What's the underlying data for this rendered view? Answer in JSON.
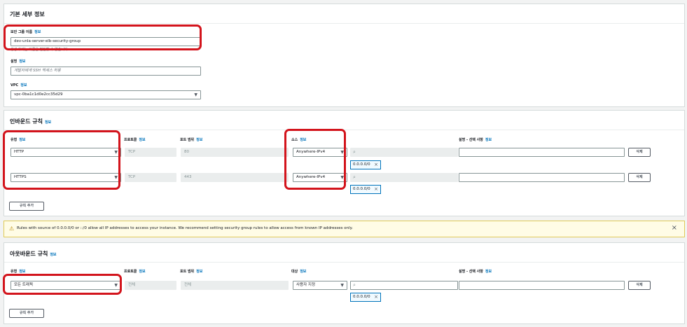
{
  "basic": {
    "title": "기본 세부 정보",
    "info": "정보",
    "sg_name_label": "보안 그룹 이름",
    "sg_name_value": "dev-unla-server-elb-security-group",
    "sg_name_hint": "생성 후에는 이름을 편집할 수 없습니다.",
    "desc_label": "설명",
    "desc_placeholder": "개발자에게 SSH 액세스 허용",
    "vpc_label": "VPC",
    "vpc_value": "vpc-0ba1c1d0e2cc35d29"
  },
  "inbound": {
    "title": "인바운드 규칙",
    "info": "정보",
    "col_type": "유형",
    "col_protocol": "프로토콜",
    "col_port": "포트 범위",
    "col_source": "소스",
    "col_desc": "설명 - 선택 사항",
    "rows": [
      {
        "type": "HTTP",
        "protocol": "TCP",
        "port": "80",
        "source": "Anywhere-IPv4",
        "cidr": "0.0.0.0/0"
      },
      {
        "type": "HTTPS",
        "protocol": "TCP",
        "port": "443",
        "source": "Anywhere-IPv4",
        "cidr": "0.0.0.0/0"
      }
    ],
    "delete_label": "삭제",
    "add_rule_label": "규칙 추가"
  },
  "warning": {
    "text": "Rules with source of 0.0.0.0/0 or ::/0 allow all IP addresses to access your instance. We recommend setting security group rules to allow access from known IP addresses only."
  },
  "outbound": {
    "title": "아웃바운드 규칙",
    "info": "정보",
    "col_type": "유형",
    "col_protocol": "프로토콜",
    "col_port": "포트 범위",
    "col_dest": "대상",
    "col_desc": "설명 - 선택 사항",
    "row": {
      "type": "모든 트래픽",
      "protocol": "전체",
      "port": "전체",
      "dest": "사용자 지정",
      "cidr": "0.0.0.0/0"
    },
    "delete_label": "삭제",
    "add_rule_label": "규칙 추가"
  },
  "icons": {
    "chevron": "chevron-down-icon",
    "search": "search-icon",
    "close": "close-icon",
    "warning": "warning-icon"
  }
}
